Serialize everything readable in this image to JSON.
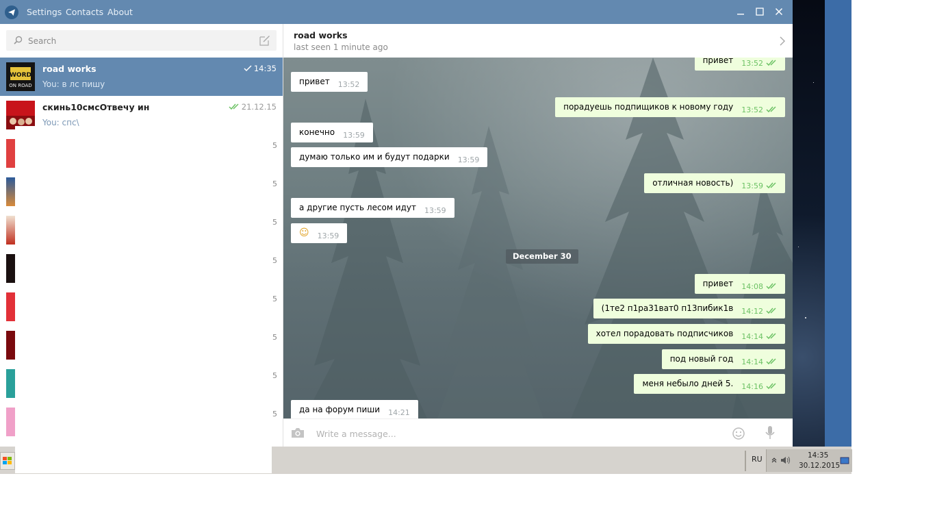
{
  "titlebar": {
    "menu": [
      "Settings",
      "Contacts",
      "About"
    ]
  },
  "search": {
    "placeholder": "Search"
  },
  "dialogs": [
    {
      "name": "road works",
      "preview": "You: в лс пишу",
      "time": "14:35",
      "checks": "single",
      "active": true
    },
    {
      "name": "скинь10смсОтвечу ин",
      "preview": "You: спс\\",
      "time": "21.12.15",
      "checks": "double",
      "active": false
    }
  ],
  "dialog_strip_digits": [
    "5",
    "5",
    "5",
    "5",
    "5",
    "5",
    "5",
    "5"
  ],
  "chat": {
    "peer_name": "road works",
    "peer_status": "last seen 1 minute ago",
    "date_separator": "December 30",
    "composer_placeholder": "Write a message...",
    "messages": [
      {
        "dir": "out",
        "text": "привет",
        "time": "13:52"
      },
      {
        "dir": "in",
        "text": "привет",
        "time": "13:52"
      },
      {
        "dir": "out",
        "text": "порадуешь подпищиков к новому году",
        "time": "13:52"
      },
      {
        "dir": "in",
        "text": "конечно",
        "time": "13:59"
      },
      {
        "dir": "in",
        "text": "думаю только им и будут подарки",
        "time": "13:59"
      },
      {
        "dir": "out",
        "text": "отличная новость)",
        "time": "13:59"
      },
      {
        "dir": "in",
        "text": "а другие пусть лесом идут",
        "time": "13:59"
      },
      {
        "dir": "in",
        "text": "☺",
        "time": "13:59"
      },
      {
        "dir": "out",
        "text": "привет",
        "time": "14:08"
      },
      {
        "dir": "out",
        "text": "(1те2 п1ра31ват0 п13пибик1в",
        "time": "14:12"
      },
      {
        "dir": "out",
        "text": "хотел порадовать подписчиков",
        "time": "14:14"
      },
      {
        "dir": "out",
        "text": "под новый год",
        "time": "14:14"
      },
      {
        "dir": "out",
        "text": "меня небыло дней 5.",
        "time": "14:16"
      },
      {
        "dir": "in",
        "text": "да на форум пиши",
        "time": "14:21"
      }
    ]
  },
  "taskbar": {
    "lang": "RU",
    "clock_time": "14:35",
    "clock_date": "30.12.2015"
  },
  "colors": {
    "titlebar": "#6389b0",
    "active_dialog": "#6389b0",
    "out_bubble": "#effedd",
    "read_check": "#6cc264"
  }
}
